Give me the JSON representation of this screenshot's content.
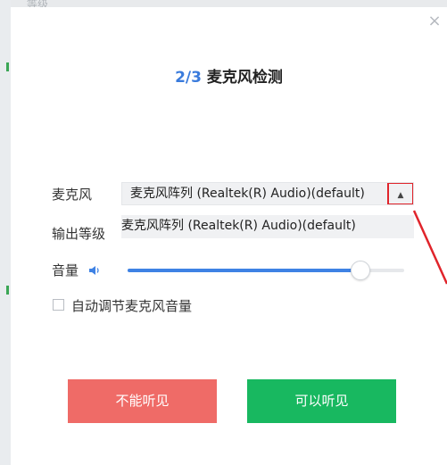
{
  "background": {
    "window_text": "等级"
  },
  "dialog": {
    "close_symbol": "×",
    "title_step": "2/3",
    "title_text": " 麦克风检测"
  },
  "microphone": {
    "label": "麦克风",
    "selected": "麦克风阵列 (Realtek(R) Audio)(default)",
    "arrow": "▲",
    "options": [
      "麦克风阵列 (Realtek(R) Audio)(default)"
    ]
  },
  "output_level": {
    "label": "输出等级"
  },
  "volume": {
    "label": "音量",
    "value_fraction": 0.84
  },
  "auto_adjust": {
    "label": "自动调节麦克风音量",
    "checked": false
  },
  "buttons": {
    "cant_hear": "不能听见",
    "can_hear": "可以听见"
  },
  "colors": {
    "accent": "#3f82e4",
    "title_step": "#3a7bdc",
    "cant_hear_bg": "#ef6b67",
    "can_hear_bg": "#18b860",
    "annotation": "#e0242b"
  }
}
